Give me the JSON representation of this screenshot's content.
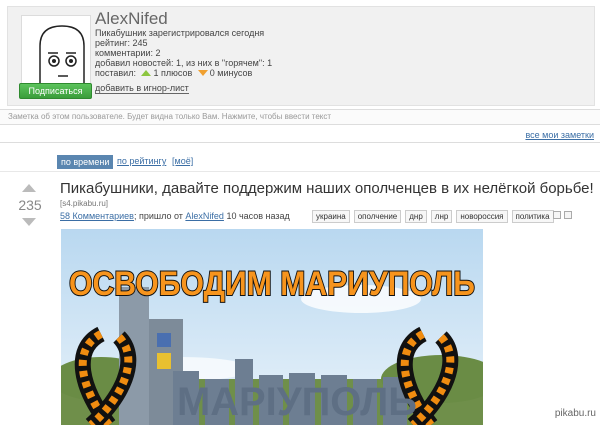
{
  "profile": {
    "username": "AlexNifed",
    "registered": "Пикабушник зарегистрировался сегодня",
    "rating": "рейтинг: 245",
    "comments": "комментарии: 2",
    "news": "добавил новостей: 1, из них в \"горячем\": 1",
    "votes_prefix": "поставил:",
    "pluses": "1 плюсов",
    "minuses": "0 минусов",
    "subscribe_label": "Подписаться",
    "ignore_label": "добавить в игнор-лист"
  },
  "note_placeholder": "Заметка об этом пользователе. Будет видна только Вам. Нажмите, чтобы ввести текст",
  "all_notes_label": "все мои заметки",
  "sort": {
    "by_time": "по времени",
    "by_rating": "по рейтингу",
    "mine": "[моё]"
  },
  "post": {
    "rating": "235",
    "title": "Пикабушники, давайте поддержим наших ополченцев в их нелёгкой борьбе!",
    "source": "[s4.pikabu.ru]",
    "comments_link": "58 Комментариев",
    "meta_mid": "; пришло от",
    "author": "AlexNifed",
    "time": "10 часов назад",
    "tags": [
      "украина",
      "ополчение",
      "днр",
      "лнр",
      "новороссия",
      "политика"
    ],
    "image_headline": "ОСВОБОДИМ МАРИУПОЛЬ",
    "image_sign": "МАРIУПОЛЬ"
  },
  "watermark": "pikabu.ru",
  "colors": {
    "accent_blue": "#5a86b0",
    "link": "#3b6ea5",
    "subscribe_green": "#4caf50",
    "plus": "#8cc63f",
    "minus": "#f0a030",
    "headline_orange": "#f7941d"
  }
}
